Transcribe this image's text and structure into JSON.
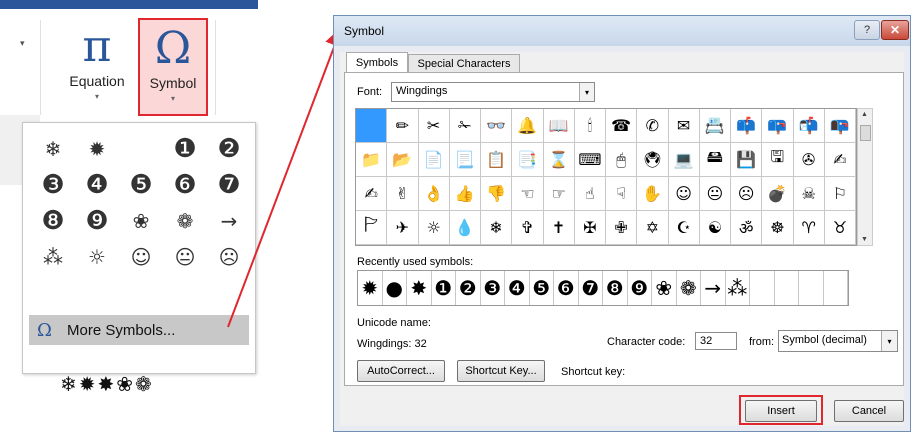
{
  "ribbon": {
    "dropdown_caret": "▾",
    "equation": {
      "glyph": "π",
      "label": "Equation",
      "caret": "▾"
    },
    "symbol": {
      "glyph": "Ω",
      "label": "Symbol",
      "caret": "▾"
    }
  },
  "gallery": {
    "symbols": [
      "❄",
      "✹",
      "",
      "❶",
      "❷",
      "❸",
      "❹",
      "❺",
      "❻",
      "❼",
      "❽",
      "❾",
      "❀",
      "❁",
      "→",
      "⁂",
      "☼",
      "☺",
      "😐",
      "☹"
    ],
    "more_icon": "Ω",
    "more_label": "More Symbols..."
  },
  "inserted_symbols": "❄✹✸❀❁",
  "dialog": {
    "title": "Symbol",
    "help": "?",
    "close": "✕",
    "tabs": {
      "symbols": "Symbols",
      "special": "Special Characters"
    },
    "font": {
      "label": "Font:",
      "value": "Wingdings",
      "arrow": "▾"
    },
    "grid": [
      "",
      "✏",
      "✂",
      "✁",
      "👓",
      "🔔",
      "📖",
      "🕯",
      "☎",
      "✆",
      "✉",
      "📇",
      "📫",
      "📪",
      "📬",
      "📭",
      "📁",
      "📂",
      "📄",
      "📃",
      "📋",
      "📑",
      "⌛",
      "⌨",
      "🖱",
      "🖲",
      "💻",
      "🖴",
      "💾",
      "🖫",
      "✇",
      "✍",
      "✍",
      "✌",
      "👌",
      "👍",
      "👎",
      "☜",
      "☞",
      "☝",
      "☟",
      "✋",
      "☺",
      "😐",
      "☹",
      "💣",
      "☠",
      "⚐",
      "🏱",
      "✈",
      "☼",
      "💧",
      "❄",
      "✞",
      "✝",
      "✠",
      "✙",
      "✡",
      "☪",
      "☯",
      "ॐ",
      "☸",
      "♈",
      "♉"
    ],
    "scroll_up": "▲",
    "scroll_down": "▼",
    "recent_label": "Recently used symbols:",
    "recent": [
      "✹",
      "●",
      "✸",
      "❶",
      "❷",
      "❸",
      "❹",
      "❺",
      "❻",
      "❼",
      "❽",
      "❾",
      "❀",
      "❁",
      "→",
      "⁂",
      "",
      "",
      "",
      ""
    ],
    "unicode_name_label": "Unicode name:",
    "unicode_name_value": "Wingdings: 32",
    "char_code_label": "Character code:",
    "char_code_value": "32",
    "from_label": "from:",
    "from_value": "Symbol (decimal)",
    "from_arrow": "▾",
    "autocorrect_label": "AutoCorrect...",
    "shortcut_key_btn_label": "Shortcut Key...",
    "shortcut_key_label": "Shortcut key:",
    "insert_label": "Insert",
    "cancel_label": "Cancel"
  },
  "colors": {
    "highlight": "#e0262e",
    "accent": "#2b579a",
    "selected_cell": "#3399ff"
  }
}
